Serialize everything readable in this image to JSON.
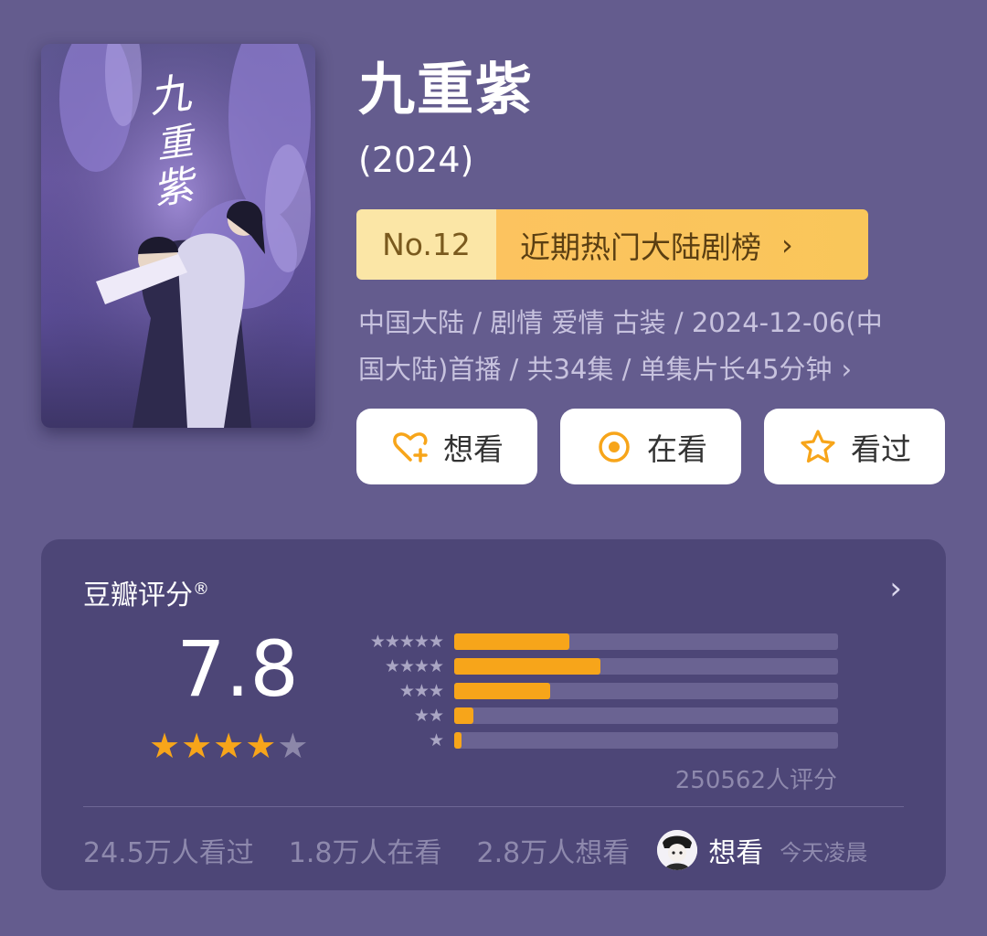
{
  "poster": {
    "calligraphy": "九重紫"
  },
  "header": {
    "title": "九重紫",
    "year": "(2024)"
  },
  "ranking": {
    "number": "No.12",
    "label": "近期热门大陆剧榜",
    "chevron": "›"
  },
  "meta": {
    "line1": "中国大陆 / 剧情 爱情 古装 / 2024-12-06(中",
    "line2": "国大陆)首播 / 共34集 / 单集片长45分钟",
    "chevron": "›"
  },
  "actions": [
    {
      "label": "想看",
      "icon": "heart-plus-icon"
    },
    {
      "label": "在看",
      "icon": "target-circle-icon"
    },
    {
      "label": "看过",
      "icon": "star-outline-icon"
    }
  ],
  "rating": {
    "title": "豆瓣评分",
    "registered": "®",
    "chevron": "›",
    "score": "7.8",
    "score_stars": {
      "full": 4,
      "empty": 1
    },
    "distribution": [
      {
        "stars": "★★★★★",
        "fraction": 0.3
      },
      {
        "stars": "★★★★",
        "fraction": 0.38
      },
      {
        "stars": "★★★",
        "fraction": 0.25
      },
      {
        "stars": "★★",
        "fraction": 0.05
      },
      {
        "stars": "★",
        "fraction": 0.02
      }
    ],
    "count_text": "250562人评分"
  },
  "stats": {
    "watched": "24.5万人看过",
    "watching": "1.8万人在看",
    "want": "2.8万人想看",
    "friend_action": "想看",
    "friend_time": "今天凌晨"
  },
  "colors": {
    "background": "#645c8e",
    "card": "#4d4677",
    "accent": "#f7a51a",
    "rank_light": "#fbe6a6",
    "rank_dark": "#fcc35f"
  }
}
